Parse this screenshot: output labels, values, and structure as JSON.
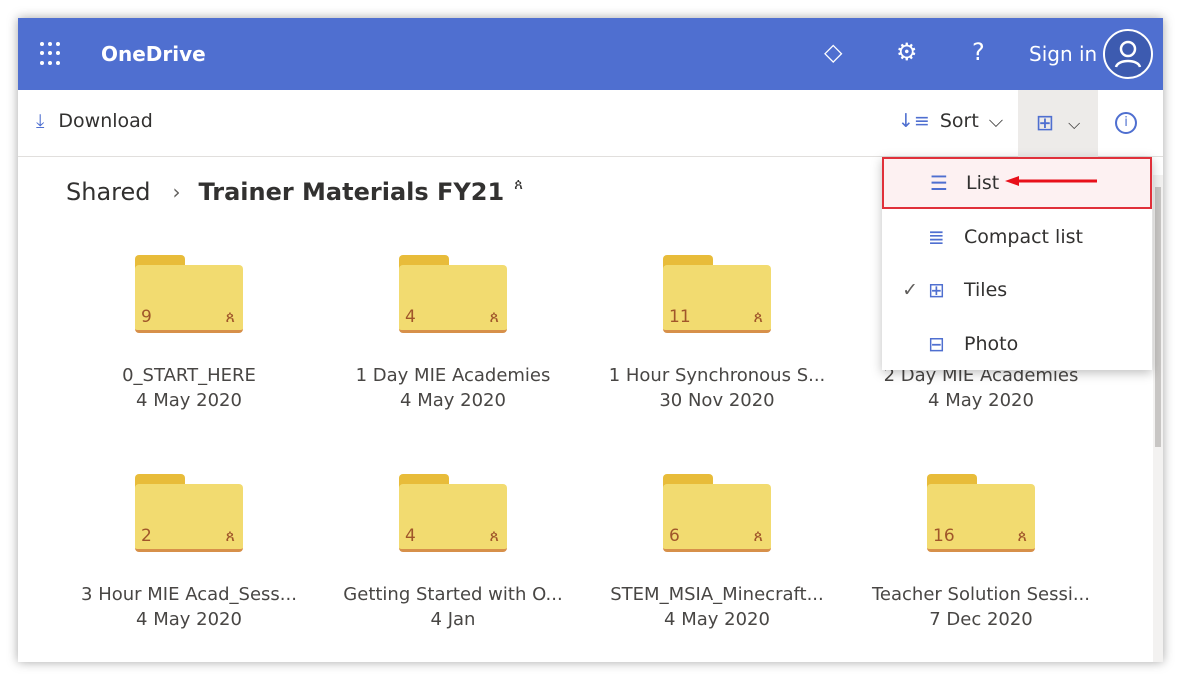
{
  "header": {
    "app_name": "OneDrive",
    "sign_in": "Sign in",
    "icons": [
      "waffle-icon",
      "diamond-icon",
      "gear-icon",
      "help-icon",
      "avatar-icon"
    ],
    "color": "#4f6fd0"
  },
  "toolbar": {
    "download": "Download",
    "sort": "Sort"
  },
  "breadcrumb": {
    "parent": "Shared",
    "current": "Trainer Materials FY21"
  },
  "view_menu": {
    "items": [
      {
        "label": "List",
        "highlighted": true
      },
      {
        "label": "Compact list"
      },
      {
        "label": "Tiles",
        "checked": true
      },
      {
        "label": "Photo"
      }
    ]
  },
  "folders": [
    {
      "name": "0_START_HERE",
      "date": "4 May 2020",
      "count": "9"
    },
    {
      "name": "1 Day MIE Academies",
      "date": "4 May 2020",
      "count": "4"
    },
    {
      "name": "1 Hour Synchronous S...",
      "date": "30 Nov 2020",
      "count": "11"
    },
    {
      "name": "2 Day MIE Academies",
      "date": "4 May 2020",
      "count": ""
    },
    {
      "name": "3 Hour MIE Acad_Sess...",
      "date": "4 May 2020",
      "count": "2"
    },
    {
      "name": "Getting Started with O...",
      "date": "4 Jan",
      "count": "4"
    },
    {
      "name": "STEM_MSIA_Minecraft...",
      "date": "4 May 2020",
      "count": "6"
    },
    {
      "name": "Teacher Solution Sessi...",
      "date": "7 Dec 2020",
      "count": "16"
    }
  ]
}
